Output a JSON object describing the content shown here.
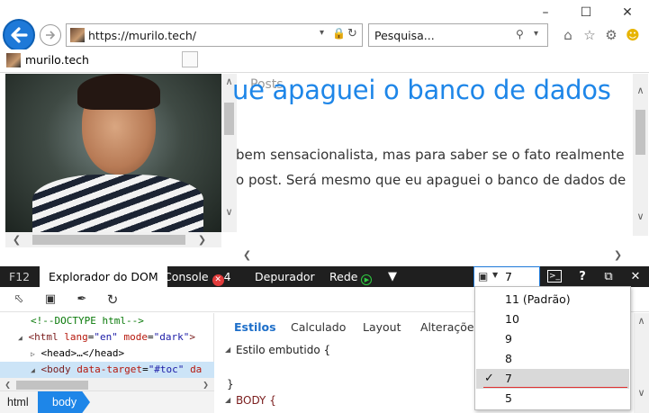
{
  "browser": {
    "url": "https://murilo.tech/",
    "search_placeholder": "Pesquisa...",
    "tab_title": "murilo.tech",
    "window_controls": [
      "minimize-icon",
      "maximize-icon",
      "close-icon"
    ],
    "toolbar_icons": [
      "home-icon",
      "star-icon",
      "gear-icon",
      "smiley-icon"
    ]
  },
  "page": {
    "posts_label": "Posts",
    "headline": "ue apaguei o banco de dados",
    "body_lines": [
      "bem sensacionalista, mas para saber se o fato realmente",
      "o post. Será mesmo que eu apaguei o banco de dados de"
    ]
  },
  "devtools": {
    "f12_label": "F12",
    "tabs": [
      {
        "label": "Explorador do DOM",
        "active": true
      },
      {
        "label": "Console",
        "errors": "4"
      },
      {
        "label": "Depurador"
      },
      {
        "label": "Rede"
      }
    ],
    "emulation_value": "7",
    "dom_lines": [
      {
        "comment": "<!--DOCTYPE html-->"
      },
      {
        "tag_open": "<html",
        "attrs": [
          {
            "name": "lang",
            "value": "\"en\""
          },
          {
            "name": "mode",
            "value": "\"dark\""
          }
        ],
        "tag_close": ">"
      },
      {
        "text": "<head>…</head>"
      },
      {
        "tag_open": "<body",
        "attrs": [
          {
            "name": "data-target",
            "value": "\"#toc\""
          },
          {
            "name": "da",
            "value": ""
          }
        ],
        "tag_close": ""
      }
    ],
    "breadcrumb": [
      "html",
      "body"
    ],
    "style_tabs": [
      "Estilos",
      "Calculado",
      "Layout",
      "Alterações"
    ],
    "style_lines": [
      "Estilo embutido  {",
      "}",
      "BODY  {"
    ],
    "document_modes": [
      {
        "label": "11 (Padrão)",
        "selected": false
      },
      {
        "label": "10",
        "selected": false
      },
      {
        "label": "9",
        "selected": false
      },
      {
        "label": "8",
        "selected": false
      },
      {
        "label": "7",
        "selected": true
      },
      {
        "label": "5",
        "selected": false
      }
    ],
    "colors": {
      "accent": "#1e86e8",
      "toolbar_bg": "#1f1f1f",
      "error": "#e23b3b"
    }
  }
}
